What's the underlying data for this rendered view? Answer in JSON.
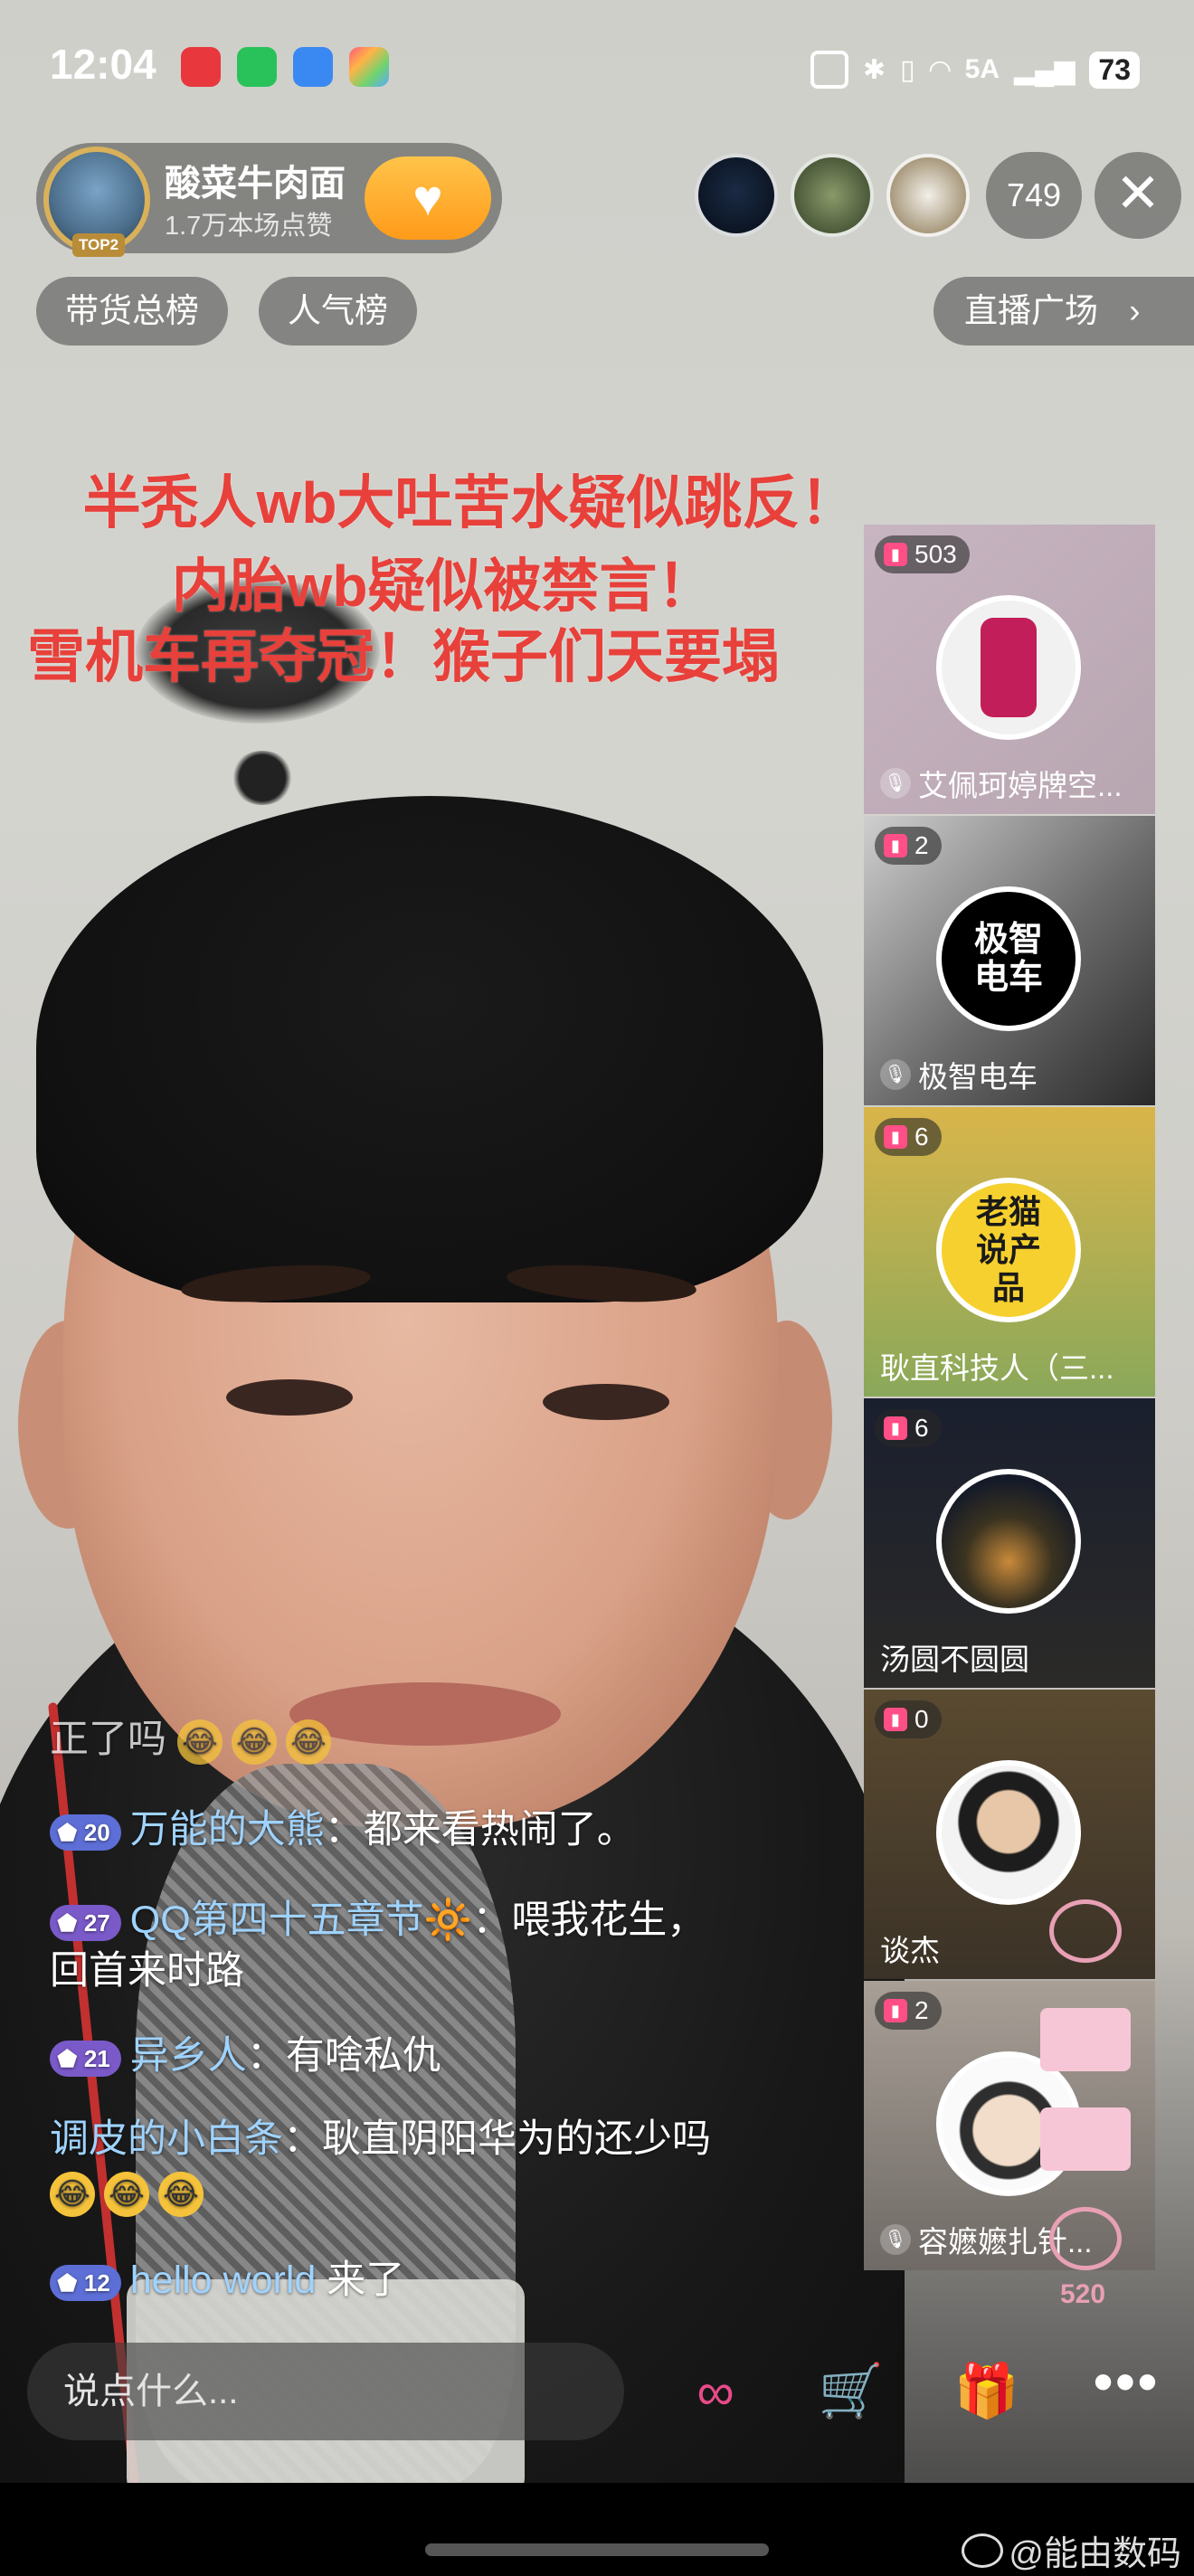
{
  "status_bar": {
    "time": "12:04",
    "network": "5A",
    "battery": "73"
  },
  "host": {
    "name": "酸菜牛肉面",
    "likes": "1.7万本场点赞",
    "rank_badge": "TOP2"
  },
  "viewers": {
    "count": "749"
  },
  "ranks": {
    "sales": "带货总榜",
    "popularity": "人气榜",
    "plaza": "直播广场"
  },
  "captions": [
    "半秃人wb大吐苦水疑似跳反！",
    "内胎wb疑似被禁言！",
    "雪机车再夺冠！猴子们天要塌"
  ],
  "streams": [
    {
      "count": "503",
      "name": "艾佩珂婷牌空...",
      "muted": true,
      "avatar_text": ""
    },
    {
      "count": "2",
      "name": "极智电车",
      "muted": true,
      "avatar_text": "极智电车"
    },
    {
      "count": "6",
      "name": "耿直科技人（三...",
      "muted": false,
      "avatar_text": "老猫说产品"
    },
    {
      "count": "6",
      "name": "汤圆不圆圆",
      "muted": false,
      "avatar_text": ""
    },
    {
      "count": "0",
      "name": "谈杰",
      "muted": false,
      "avatar_text": ""
    },
    {
      "count": "2",
      "name": "容嬷嬷扎针...",
      "muted": true,
      "avatar_text": ""
    }
  ],
  "chat": [
    {
      "level": "",
      "user": "",
      "sep": "",
      "text": "正了吗",
      "emoji": 3
    },
    {
      "level": "20",
      "user": "万能的大熊",
      "sep": "：",
      "text": "都来看热闹了。",
      "emoji": 0
    },
    {
      "level": "27",
      "user": "QQ第四十五章节",
      "sep": "：",
      "text": "喂我花生，",
      "emoji": 0
    },
    {
      "level": "",
      "user": "",
      "sep": "",
      "text": "回首来时路",
      "emoji": 0
    },
    {
      "level": "21",
      "user": "异乡人",
      "sep": "：",
      "text": "有啥私仇",
      "emoji": 0
    },
    {
      "level": "",
      "user": "调皮的小白条",
      "sep": "：",
      "text": "耿直阴阳华为的还少吗",
      "emoji": 0
    },
    {
      "level": "",
      "user": "",
      "sep": "",
      "text": "",
      "emoji": 3
    },
    {
      "level": "12",
      "user": "hello world",
      "sep": " ",
      "text": "来了",
      "emoji": 0
    }
  ],
  "bottom": {
    "input_placeholder": "说点什么...",
    "more": "•••"
  },
  "watermark": "@能由数码",
  "floating": {
    "value": "520"
  }
}
